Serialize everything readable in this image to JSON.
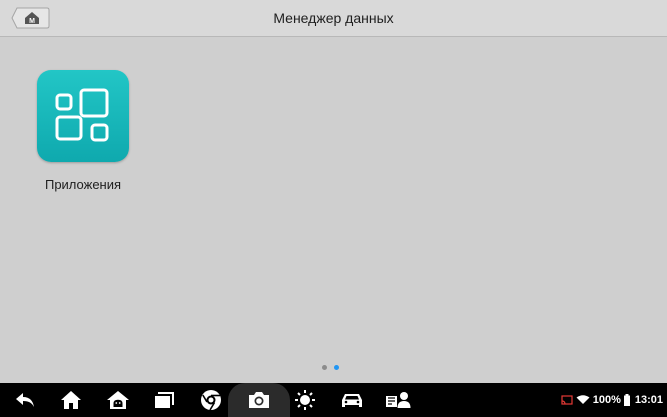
{
  "header": {
    "title": "Менеджер данных",
    "home_button_letter": "M",
    "home_button_icon": "home-m-icon"
  },
  "main": {
    "apps": [
      {
        "label": "Приложения",
        "icon": "apps-grid-icon",
        "color_top": "#22c6c6",
        "color_bottom": "#0fa9ae"
      }
    ],
    "page_indicator": {
      "pages": 2,
      "current": 2,
      "active_color": "#2196f3",
      "inactive_color": "#8c8c8c"
    }
  },
  "navbar": {
    "icons": [
      "back-icon",
      "home-icon",
      "android-home-icon",
      "recent-apps-icon",
      "browser-icon",
      "camera-icon",
      "brightness-icon",
      "car-icon",
      "vci-user-icon"
    ]
  },
  "status_bar": {
    "battery": "100%",
    "time": "13:01",
    "icons": [
      "cast-icon",
      "wifi-icon",
      "battery-icon"
    ]
  }
}
